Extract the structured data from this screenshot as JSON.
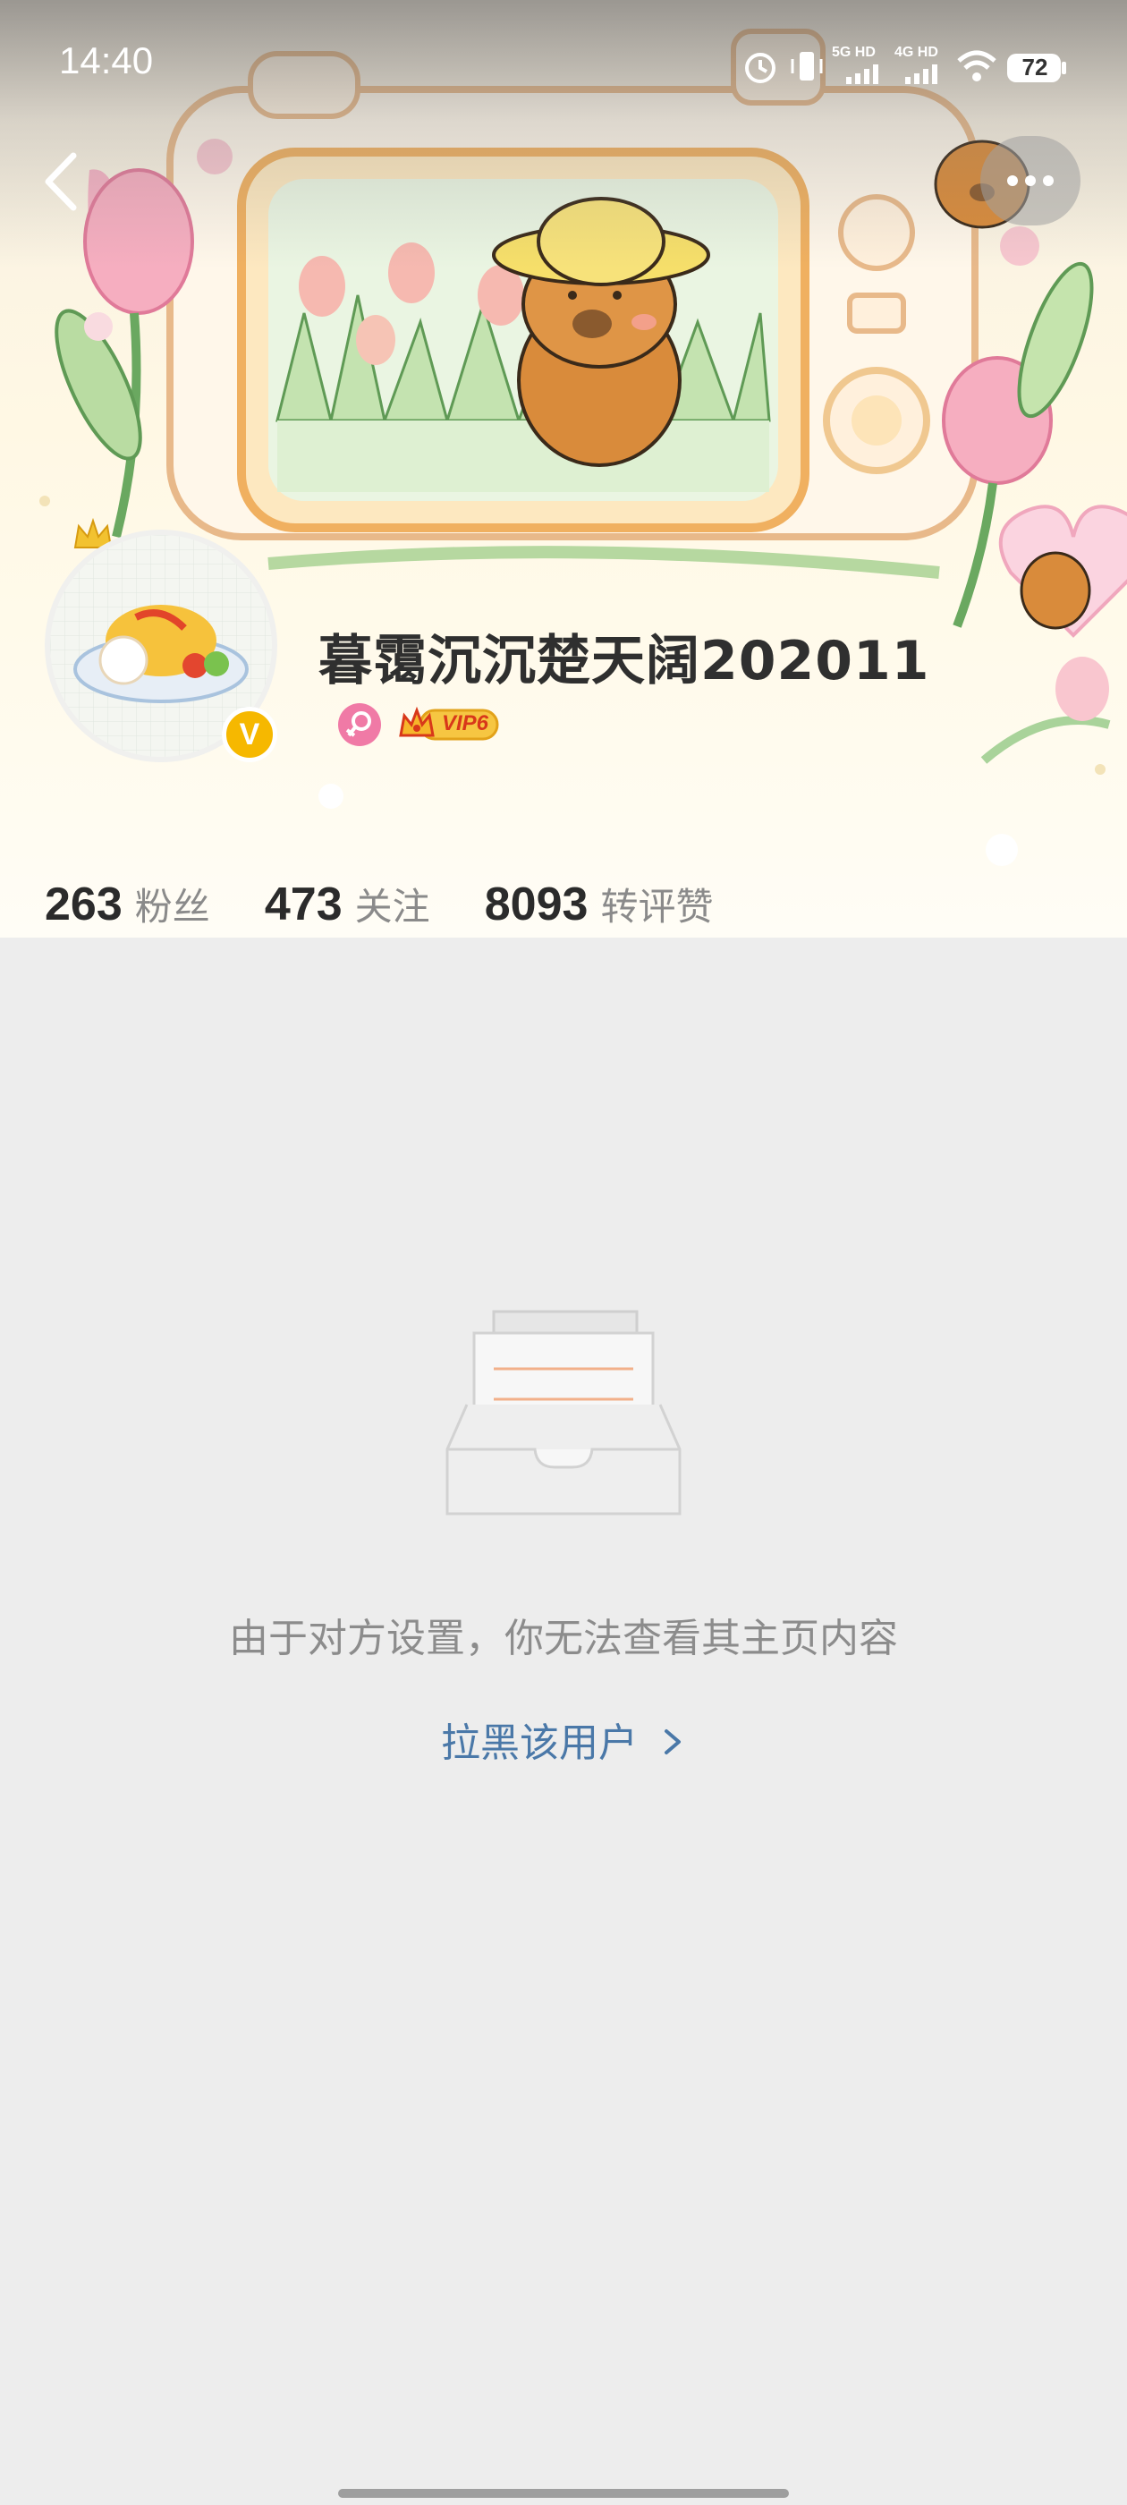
{
  "status_bar": {
    "time": "14:40",
    "signal_labels": [
      "5G HD",
      "4G HD"
    ],
    "battery": "72",
    "icons": [
      "alarm-icon",
      "vibrate-icon",
      "signal-5g-icon",
      "signal-4g-icon",
      "wifi-icon",
      "battery-icon"
    ]
  },
  "nav": {
    "back_icon": "chevron-left-icon",
    "more_icon": "more-icon"
  },
  "profile": {
    "username": "暮霭沉沉楚天阔202011",
    "verified_badge": "V",
    "gender_icon": "female-icon",
    "vip_label": "VIP6"
  },
  "stats": [
    {
      "value": "263",
      "label": "粉丝"
    },
    {
      "value": "473",
      "label": "关注"
    },
    {
      "value": "8093",
      "label": "转评赞"
    }
  ],
  "content": {
    "empty_icon": "empty-inbox-icon",
    "message": "由于对方设置，你无法查看其主页内容",
    "block_link": "拉黑该用户",
    "link_icon": "chevron-right-icon"
  },
  "colors": {
    "accent_link": "#4a78a8",
    "background": "#ededed",
    "verified": "#f6b800",
    "gender": "#f07aa6"
  }
}
